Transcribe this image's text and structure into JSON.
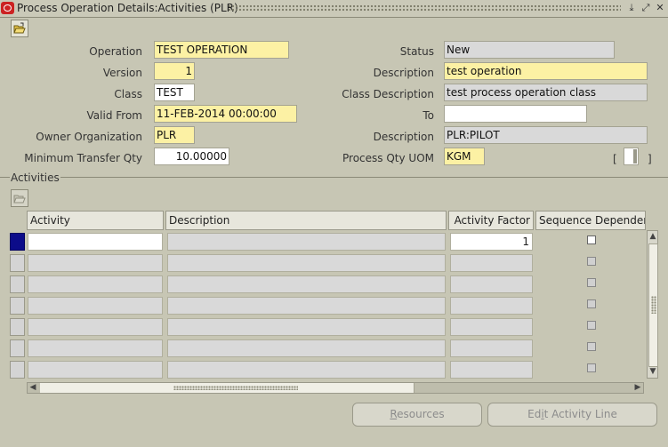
{
  "window": {
    "title": "Process Operation Details:Activities (PLR)",
    "controls": {
      "minimize": "⤓",
      "maximize": "⤢",
      "close": "✕"
    }
  },
  "toolbar": {
    "open_icon": "folder-open-icon"
  },
  "form": {
    "operation": {
      "label": "Operation",
      "value": "TEST OPERATION"
    },
    "version": {
      "label": "Version",
      "value": "1"
    },
    "class": {
      "label": "Class",
      "value": "TEST"
    },
    "valid_from": {
      "label": "Valid From",
      "value": "11-FEB-2014 00:00:00"
    },
    "owner_org": {
      "label": "Owner Organization",
      "value": "PLR"
    },
    "min_transfer_qty": {
      "label": "Minimum Transfer Qty",
      "value": "10.00000"
    },
    "status": {
      "label": "Status",
      "value": "New"
    },
    "description": {
      "label": "Description",
      "value": "test operation"
    },
    "class_description": {
      "label": "Class Description",
      "value": "test process operation class"
    },
    "to": {
      "label": "To",
      "value": ""
    },
    "org_description": {
      "label": "Description",
      "value": "PLR:PILOT"
    },
    "process_qty_uom": {
      "label": "Process Qty UOM",
      "value": "KGM"
    },
    "flex": {
      "open": "[",
      "close": "]"
    }
  },
  "activities": {
    "section_title": "Activities",
    "columns": {
      "activity": "Activity",
      "description": "Description",
      "activity_factor": "Activity Factor",
      "sequence_dependent": "Sequence Dependen"
    },
    "rows": [
      {
        "activity": "",
        "description": "",
        "activity_factor": "1",
        "sequence_dependent": false
      },
      {
        "activity": "",
        "description": "",
        "activity_factor": "",
        "sequence_dependent": false
      },
      {
        "activity": "",
        "description": "",
        "activity_factor": "",
        "sequence_dependent": false
      },
      {
        "activity": "",
        "description": "",
        "activity_factor": "",
        "sequence_dependent": false
      },
      {
        "activity": "",
        "description": "",
        "activity_factor": "",
        "sequence_dependent": false
      },
      {
        "activity": "",
        "description": "",
        "activity_factor": "",
        "sequence_dependent": false
      },
      {
        "activity": "",
        "description": "",
        "activity_factor": "",
        "sequence_dependent": false
      }
    ]
  },
  "buttons": {
    "resources": {
      "mnemonic": "R",
      "rest": "esources"
    },
    "edit_activity_line": {
      "pre": "Ed",
      "mnemonic": "i",
      "rest": "t Activity Line"
    }
  },
  "colors": {
    "required_field": "#fcf1a4",
    "readonly_field": "#d9d9d9",
    "background": "#c7c6b4",
    "active_row_indicator": "#0c0c8a"
  }
}
